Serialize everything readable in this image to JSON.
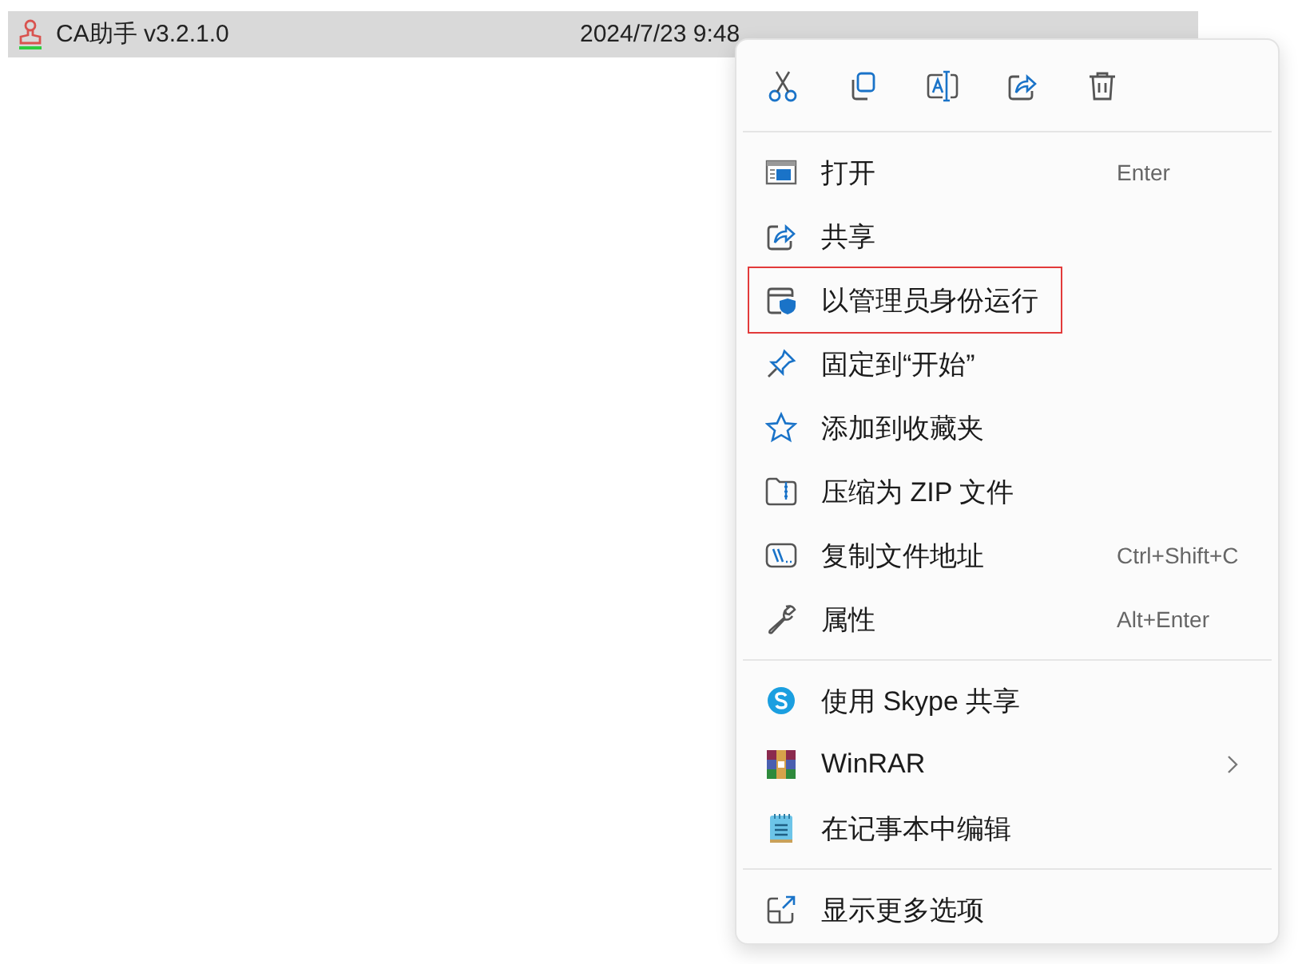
{
  "file_row": {
    "name": "CA助手 v3.2.1.0",
    "modified": "2024/7/23 9:48",
    "selected": true
  },
  "context_menu": {
    "sections": [
      [
        {
          "label": "打开",
          "shortcut": "Enter",
          "highlighted": false,
          "submenu": false
        },
        {
          "label": "共享",
          "highlighted": false,
          "submenu": false
        },
        {
          "label": "以管理员身份运行",
          "highlighted": true,
          "submenu": false
        },
        {
          "label": "固定到“开始”",
          "highlighted": false,
          "submenu": false
        },
        {
          "label": "添加到收藏夹",
          "highlighted": false,
          "submenu": false
        },
        {
          "label": "压缩为 ZIP 文件",
          "highlighted": false,
          "submenu": false
        },
        {
          "label": "复制文件地址",
          "shortcut": "Ctrl+Shift+C",
          "highlighted": false,
          "submenu": false
        },
        {
          "label": "属性",
          "shortcut": "Alt+Enter",
          "highlighted": false,
          "submenu": false
        }
      ],
      [
        {
          "label": "使用 Skype 共享",
          "highlighted": false,
          "submenu": false
        },
        {
          "label": "WinRAR",
          "highlighted": false,
          "submenu": true
        },
        {
          "label": "在记事本中编辑",
          "highlighted": false,
          "submenu": false
        }
      ],
      [
        {
          "label": "显示更多选项",
          "highlighted": false,
          "submenu": false
        }
      ]
    ]
  }
}
